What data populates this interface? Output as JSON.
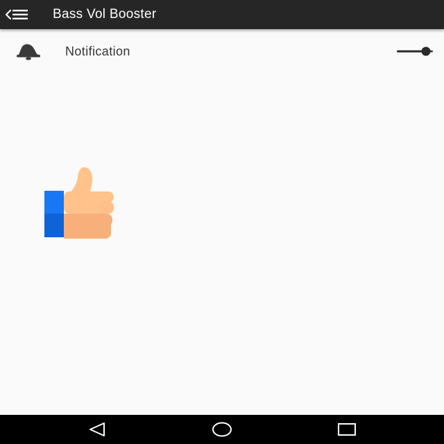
{
  "app": {
    "title": "Bass Vol Booster",
    "toolbar_color": "#262626",
    "background_color": "#fafafa"
  },
  "toolbar": {
    "nav_icon": "menu-back-icon"
  },
  "settings": [
    {
      "icon": "bell-icon",
      "label": "Notification",
      "toggle_on": false
    }
  ],
  "content": {
    "illustration": "thumbs-up-icon"
  },
  "system_nav": {
    "buttons": [
      "back-icon",
      "home-icon",
      "recents-icon"
    ]
  }
}
